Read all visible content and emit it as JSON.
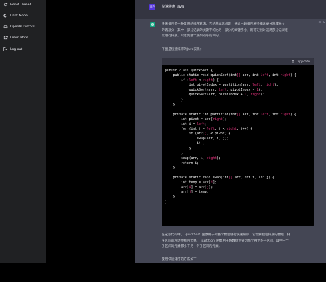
{
  "sidebar": {
    "items": [
      {
        "label": "Reset Thread",
        "icon": "refresh-icon"
      },
      {
        "label": "Dark Mode",
        "icon": "moon-icon"
      },
      {
        "label": "OpenAI Discord",
        "icon": "discord-icon"
      },
      {
        "label": "Learn More",
        "icon": "external-link-icon"
      },
      {
        "label": "Log out",
        "icon": "logout-icon"
      }
    ]
  },
  "conversation": {
    "user": {
      "avatar_text": "用户",
      "message": "快速排序 Java"
    },
    "assistant": {
      "paragraph_1_line_1": "快速排序是一种常用的排序算法。它的基本思想是：通过一趟排序将待排记录分割成独立",
      "paragraph_1_line_2": "的两部分，其中一部分记录的关键字均比另一部分的关键字小，则可分别对这两部分记录继",
      "paragraph_1_line_3": "续进行排序，以达到整个序列有序的目的。",
      "paragraph_2": "下面是快速排序的Java实现：",
      "copy_label": "Copy code",
      "code_lines": [
        [
          [
            "public class QuickSort {",
            ""
          ]
        ],
        [
          [
            "    public static void quickSort(int",
            ""
          ],
          [
            "[]",
            "hl"
          ],
          [
            " arr, int ",
            ""
          ],
          [
            "left",
            "hl"
          ],
          [
            ", int ",
            ""
          ],
          [
            "right",
            "hl"
          ],
          [
            ") {",
            ""
          ]
        ],
        [
          [
            "        if (",
            ""
          ],
          [
            "left",
            "hl"
          ],
          [
            " < ",
            ""
          ],
          [
            "right",
            "hl"
          ],
          [
            ") {",
            ""
          ]
        ],
        [
          [
            "            int pivotIndex = partition(arr, ",
            ""
          ],
          [
            "left",
            "hl"
          ],
          [
            ", ",
            ""
          ],
          [
            "right",
            "hl"
          ],
          [
            ");",
            ""
          ]
        ],
        [
          [
            "            quickSort(arr, ",
            ""
          ],
          [
            "left",
            "hl"
          ],
          [
            ", pivotIndex - ",
            ""
          ],
          [
            "1",
            "hl"
          ],
          [
            ");",
            ""
          ]
        ],
        [
          [
            "            quickSort(arr, pivotIndex + ",
            ""
          ],
          [
            "1",
            "hl"
          ],
          [
            ", ",
            ""
          ],
          [
            "right",
            "hl"
          ],
          [
            ");",
            ""
          ]
        ],
        [
          [
            "        }",
            ""
          ]
        ],
        [
          [
            "    }",
            ""
          ]
        ],
        [
          [
            "",
            ""
          ]
        ],
        [
          [
            "    private static int partition(int",
            ""
          ],
          [
            "[]",
            "hl"
          ],
          [
            " arr, int ",
            ""
          ],
          [
            "left",
            "hl"
          ],
          [
            ", int ",
            ""
          ],
          [
            "right",
            "hl"
          ],
          [
            ") {",
            ""
          ]
        ],
        [
          [
            "        int pivot = arr[",
            ""
          ],
          [
            "right",
            "hl"
          ],
          [
            "];",
            ""
          ]
        ],
        [
          [
            "        int i = ",
            ""
          ],
          [
            "left",
            "hl"
          ],
          [
            ";",
            ""
          ]
        ],
        [
          [
            "        for (int j = ",
            ""
          ],
          [
            "left",
            "hl"
          ],
          [
            "; j < ",
            ""
          ],
          [
            "right",
            "hl"
          ],
          [
            "; j++) {",
            ""
          ]
        ],
        [
          [
            "            if (arr[",
            ""
          ],
          [
            "j",
            "hl"
          ],
          [
            "] < pivot) {",
            ""
          ]
        ],
        [
          [
            "                swap(arr, i, j);",
            ""
          ]
        ],
        [
          [
            "                i++;",
            ""
          ]
        ],
        [
          [
            "            }",
            ""
          ]
        ],
        [
          [
            "        }",
            ""
          ]
        ],
        [
          [
            "        swap(arr, i, ",
            ""
          ],
          [
            "right",
            "hl"
          ],
          [
            ");",
            ""
          ]
        ],
        [
          [
            "        return i;",
            ""
          ]
        ],
        [
          [
            "    }",
            ""
          ]
        ],
        [
          [
            "",
            ""
          ]
        ],
        [
          [
            "    private static void swap(int",
            ""
          ],
          [
            "[]",
            "hl"
          ],
          [
            " arr, int i, int j) {",
            ""
          ]
        ],
        [
          [
            "        int temp = arr[",
            ""
          ],
          [
            "i",
            "hl"
          ],
          [
            "];",
            ""
          ]
        ],
        [
          [
            "        arr[",
            ""
          ],
          [
            "i",
            "hl"
          ],
          [
            "] = arr[",
            ""
          ],
          [
            "j",
            "hl"
          ],
          [
            "];",
            ""
          ]
        ],
        [
          [
            "        arr[",
            ""
          ],
          [
            "j",
            "hl"
          ],
          [
            "] = temp;",
            ""
          ]
        ],
        [
          [
            "    }",
            ""
          ]
        ],
        [
          [
            "}",
            ""
          ]
        ]
      ],
      "paragraph_3_line_1": "在这段代码中，`quickSort`函数用于对整个数组进行快速排序，它需要指定排序的数组、排",
      "paragraph_3_line_2": "序区间的左边界和右边界。`partition`函数用于将数组划分为两个独立的子区间，其中一个",
      "paragraph_3_line_3": "子区间的元素都小于另一个子区间的元素。",
      "paragraph_4": "使用快速排序的方法如下："
    }
  }
}
